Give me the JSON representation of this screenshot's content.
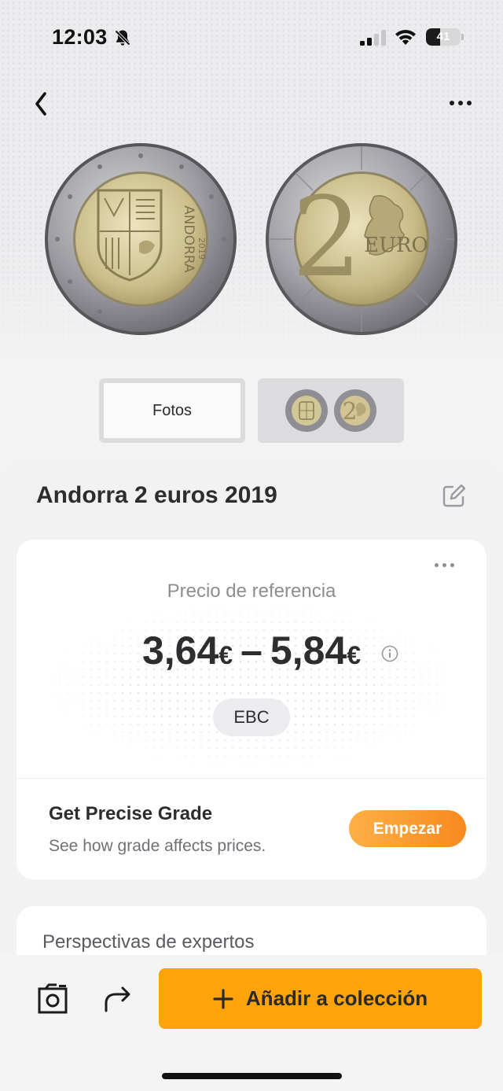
{
  "status_bar": {
    "time": "12:03",
    "battery_level": "41",
    "battery_fraction": 0.41,
    "icons": [
      "bell-slash-icon",
      "cellular-signal-icon",
      "wifi-icon",
      "battery-icon"
    ]
  },
  "nav": {
    "back_icon": "chevron-left-icon",
    "more_icon": "ellipsis-icon"
  },
  "gallery": {
    "photos_label": "Fotos"
  },
  "coin": {
    "title": "Andorra 2 euros 2019",
    "obverse_text": "ANDORRA",
    "obverse_year": "2019",
    "reverse_value": "2",
    "reverse_text": "EURO"
  },
  "price_card": {
    "label": "Precio de referencia",
    "min_value": "3,64",
    "max_value": "5,84",
    "currency": "€",
    "separator": "–",
    "grade": "EBC",
    "grade_title": "Get Precise Grade",
    "grade_subtitle": "See how grade affects prices.",
    "start_button": "Empezar"
  },
  "experts": {
    "title": "Perspectivas de expertos"
  },
  "bottom_bar": {
    "add_button": "Añadir a colección",
    "camera_icon": "camera-icon",
    "share_icon": "share-arrow-icon"
  },
  "colors": {
    "accent": "#fea40a",
    "start_button_from": "#fdb046",
    "start_button_to": "#f78a1e",
    "title_text": "#2d2d30"
  }
}
